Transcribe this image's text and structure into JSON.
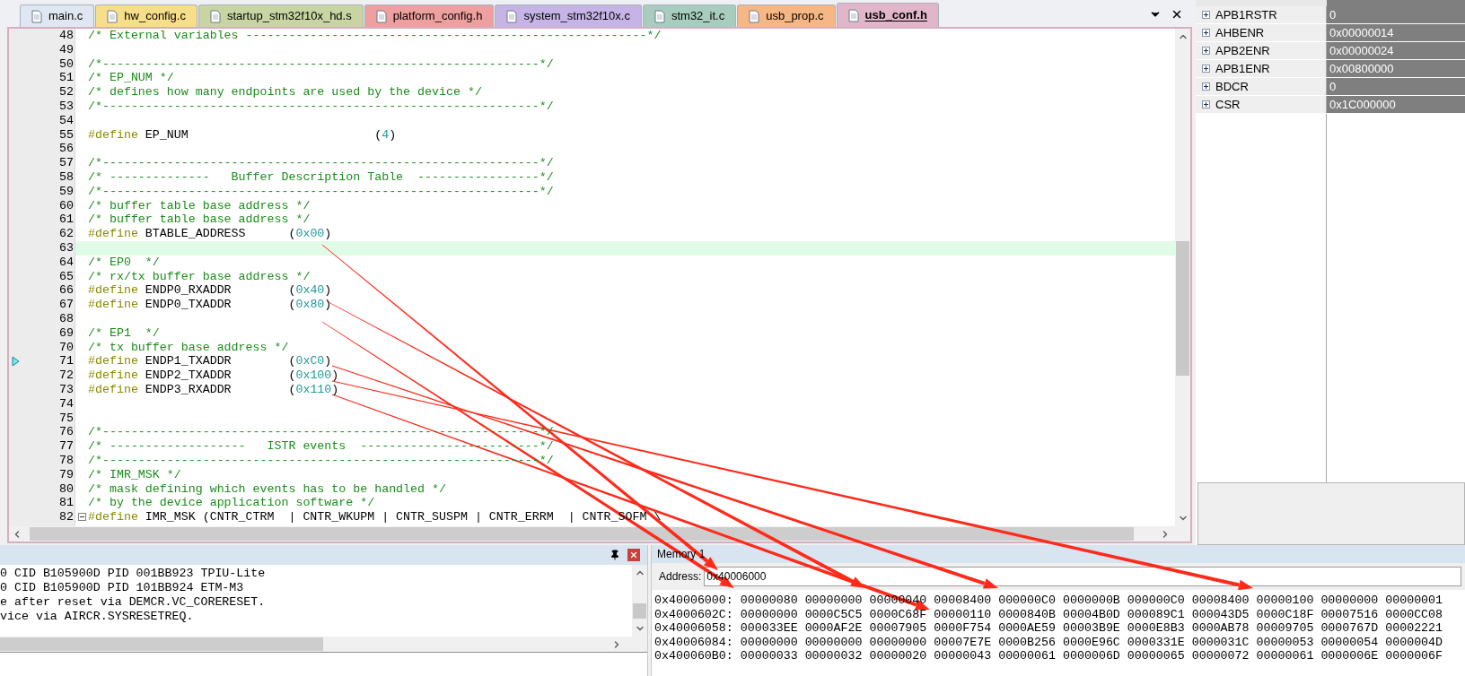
{
  "tabs": [
    {
      "label": "main.c",
      "selected": false,
      "color": "#dfe7f2"
    },
    {
      "label": "hw_config.c",
      "selected": false,
      "color": "#f7de8a"
    },
    {
      "label": "startup_stm32f10x_hd.s",
      "selected": false,
      "color": "#c8d5a2"
    },
    {
      "label": "platform_config.h",
      "selected": false,
      "color": "#ee9f9f"
    },
    {
      "label": "system_stm32f10x.c",
      "selected": false,
      "color": "#c6b4e6"
    },
    {
      "label": "stm32_it.c",
      "selected": false,
      "color": "#a8cdbf"
    },
    {
      "label": "usb_prop.c",
      "selected": false,
      "color": "#f6b784"
    },
    {
      "label": "usb_conf.h",
      "selected": true,
      "color": "#e2b6ca"
    }
  ],
  "editor": {
    "lines": [
      {
        "number": "48",
        "current": false,
        "pc": false,
        "fold": false,
        "tokens": [
          {
            "kind": "comment",
            "text": "/* External variables --------------------------------------------------------*/"
          }
        ]
      },
      {
        "number": "49",
        "current": false,
        "pc": false,
        "fold": false
      },
      {
        "number": "50",
        "current": false,
        "pc": false,
        "fold": false,
        "tokens": [
          {
            "kind": "comment",
            "text": "/*-------------------------------------------------------------*/"
          }
        ]
      },
      {
        "number": "51",
        "current": false,
        "pc": false,
        "fold": false,
        "tokens": [
          {
            "kind": "comment",
            "text": "/* EP_NUM */"
          }
        ]
      },
      {
        "number": "52",
        "current": false,
        "pc": false,
        "fold": false,
        "tokens": [
          {
            "kind": "comment",
            "text": "/* defines how many endpoints are used by the device */"
          }
        ]
      },
      {
        "number": "53",
        "current": false,
        "pc": false,
        "fold": false,
        "tokens": [
          {
            "kind": "comment",
            "text": "/*-------------------------------------------------------------*/"
          }
        ]
      },
      {
        "number": "54",
        "current": false,
        "pc": false,
        "fold": false
      },
      {
        "number": "55",
        "current": false,
        "pc": false,
        "fold": false,
        "tokens": [
          {
            "kind": "directive",
            "text": "#define"
          },
          {
            "kind": "plain",
            "text": " EP_NUM                          ("
          },
          {
            "kind": "number",
            "text": "4"
          },
          {
            "kind": "plain",
            "text": ")"
          }
        ]
      },
      {
        "number": "56",
        "current": false,
        "pc": false,
        "fold": false
      },
      {
        "number": "57",
        "current": false,
        "pc": false,
        "fold": false,
        "tokens": [
          {
            "kind": "comment",
            "text": "/*-------------------------------------------------------------*/"
          }
        ]
      },
      {
        "number": "58",
        "current": false,
        "pc": false,
        "fold": false,
        "tokens": [
          {
            "kind": "comment",
            "text": "/* --------------   Buffer Description Table  -----------------*/"
          }
        ]
      },
      {
        "number": "59",
        "current": false,
        "pc": false,
        "fold": false,
        "tokens": [
          {
            "kind": "comment",
            "text": "/*-------------------------------------------------------------*/"
          }
        ]
      },
      {
        "number": "60",
        "current": false,
        "pc": false,
        "fold": false,
        "tokens": [
          {
            "kind": "comment",
            "text": "/* buffer table base address */"
          }
        ]
      },
      {
        "number": "61",
        "current": false,
        "pc": false,
        "fold": false,
        "tokens": [
          {
            "kind": "comment",
            "text": "/* buffer table base address */"
          }
        ]
      },
      {
        "number": "62",
        "current": false,
        "pc": false,
        "fold": false,
        "tokens": [
          {
            "kind": "directive",
            "text": "#define"
          },
          {
            "kind": "plain",
            "text": " BTABLE_ADDRESS      ("
          },
          {
            "kind": "number",
            "text": "0x00"
          },
          {
            "kind": "plain",
            "text": ")"
          }
        ]
      },
      {
        "number": "63",
        "current": true,
        "pc": false,
        "fold": false
      },
      {
        "number": "64",
        "current": false,
        "pc": false,
        "fold": false,
        "tokens": [
          {
            "kind": "comment",
            "text": "/* EP0  */"
          }
        ]
      },
      {
        "number": "65",
        "current": false,
        "pc": false,
        "fold": false,
        "tokens": [
          {
            "kind": "comment",
            "text": "/* rx/tx buffer base address */"
          }
        ]
      },
      {
        "number": "66",
        "current": false,
        "pc": false,
        "fold": false,
        "tokens": [
          {
            "kind": "directive",
            "text": "#define"
          },
          {
            "kind": "plain",
            "text": " ENDP0_RXADDR        ("
          },
          {
            "kind": "number",
            "text": "0x40"
          },
          {
            "kind": "plain",
            "text": ")"
          }
        ]
      },
      {
        "number": "67",
        "current": false,
        "pc": false,
        "fold": false,
        "tokens": [
          {
            "kind": "directive",
            "text": "#define"
          },
          {
            "kind": "plain",
            "text": " ENDP0_TXADDR        ("
          },
          {
            "kind": "number",
            "text": "0x80"
          },
          {
            "kind": "plain",
            "text": ")"
          }
        ]
      },
      {
        "number": "68",
        "current": false,
        "pc": false,
        "fold": false
      },
      {
        "number": "69",
        "current": false,
        "pc": false,
        "fold": false,
        "tokens": [
          {
            "kind": "comment",
            "text": "/* EP1  */"
          }
        ]
      },
      {
        "number": "70",
        "current": false,
        "pc": false,
        "fold": false,
        "tokens": [
          {
            "kind": "comment",
            "text": "/* tx buffer base address */"
          }
        ]
      },
      {
        "number": "71",
        "current": false,
        "pc": true,
        "fold": false,
        "tokens": [
          {
            "kind": "directive",
            "text": "#define"
          },
          {
            "kind": "plain",
            "text": " ENDP1_TXADDR        ("
          },
          {
            "kind": "number",
            "text": "0xC0"
          },
          {
            "kind": "plain",
            "text": ")"
          }
        ]
      },
      {
        "number": "72",
        "current": false,
        "pc": false,
        "fold": false,
        "tokens": [
          {
            "kind": "directive",
            "text": "#define"
          },
          {
            "kind": "plain",
            "text": " ENDP2_TXADDR        ("
          },
          {
            "kind": "number",
            "text": "0x100"
          },
          {
            "kind": "plain",
            "text": ")"
          }
        ]
      },
      {
        "number": "73",
        "current": false,
        "pc": false,
        "fold": false,
        "tokens": [
          {
            "kind": "directive",
            "text": "#define"
          },
          {
            "kind": "plain",
            "text": " ENDP3_RXADDR        ("
          },
          {
            "kind": "number",
            "text": "0x110"
          },
          {
            "kind": "plain",
            "text": ")"
          }
        ]
      },
      {
        "number": "74",
        "current": false,
        "pc": false,
        "fold": false
      },
      {
        "number": "75",
        "current": false,
        "pc": false,
        "fold": false
      },
      {
        "number": "76",
        "current": false,
        "pc": false,
        "fold": false,
        "tokens": [
          {
            "kind": "comment",
            "text": "/*-------------------------------------------------------------*/"
          }
        ]
      },
      {
        "number": "77",
        "current": false,
        "pc": false,
        "fold": false,
        "tokens": [
          {
            "kind": "comment",
            "text": "/* -------------------   ISTR events  -------------------------*/"
          }
        ]
      },
      {
        "number": "78",
        "current": false,
        "pc": false,
        "fold": false,
        "tokens": [
          {
            "kind": "comment",
            "text": "/*-------------------------------------------------------------*/"
          }
        ]
      },
      {
        "number": "79",
        "current": false,
        "pc": false,
        "fold": false,
        "tokens": [
          {
            "kind": "comment",
            "text": "/* IMR_MSK */"
          }
        ]
      },
      {
        "number": "80",
        "current": false,
        "pc": false,
        "fold": false,
        "tokens": [
          {
            "kind": "comment",
            "text": "/* mask defining which events has to be handled */"
          }
        ]
      },
      {
        "number": "81",
        "current": false,
        "pc": false,
        "fold": false,
        "tokens": [
          {
            "kind": "comment",
            "text": "/* by the device application software */"
          }
        ]
      },
      {
        "number": "82",
        "current": false,
        "pc": false,
        "fold": true,
        "tokens": [
          {
            "kind": "directive",
            "text": "#define"
          },
          {
            "kind": "plain",
            "text": " IMR_MSK (CNTR_CTRM  | CNTR_WKUPM | CNTR_SUSPM | CNTR_ERRM  | CNTR_SOFM \\"
          }
        ]
      }
    ]
  },
  "registers": [
    {
      "name": "APB1RSTR",
      "value": "0",
      "expanded": false
    },
    {
      "name": "AHBENR",
      "value": "0x00000014",
      "expanded": false
    },
    {
      "name": "APB2ENR",
      "value": "0x00000024",
      "expanded": false
    },
    {
      "name": "APB1ENR",
      "value": "0x00800000",
      "expanded": false
    },
    {
      "name": "BDCR",
      "value": "0",
      "expanded": false
    },
    {
      "name": "CSR",
      "value": "0x1C000000",
      "expanded": false
    }
  ],
  "output": {
    "lines": [
      "0 CID B105900D PID 001BB923 TPIU-Lite",
      "0 CID B105900D PID 101BB924 ETM-M3",
      "e after reset via DEMCR.VC_CORERESET.",
      "vice via AIRCR.SYSRESETREQ."
    ]
  },
  "memory": {
    "title": "Memory 1",
    "address_label": "Address:",
    "address": "0x40006000",
    "rows": [
      {
        "address": "0x40006000:",
        "values": [
          "00000080",
          "00000000",
          "00000040",
          "00008400",
          "000000C0",
          "0000000B",
          "000000C0",
          "00008400",
          "00000100",
          "00000000",
          "00000001"
        ]
      },
      {
        "address": "0x4000602C:",
        "values": [
          "00000000",
          "0000C5C5",
          "0000C68F",
          "00000110",
          "0000840B",
          "00004B0D",
          "000089C1",
          "000043D5",
          "0000C18F",
          "00007516",
          "0000CC08"
        ]
      },
      {
        "address": "0x40006058:",
        "values": [
          "000033EE",
          "0000AF2E",
          "00007905",
          "0000F754",
          "0000AE59",
          "00003B9E",
          "0000E8B3",
          "0000AB78",
          "00009705",
          "0000767D",
          "00002221"
        ]
      },
      {
        "address": "0x40006084:",
        "values": [
          "00000000",
          "00000000",
          "00000000",
          "00007E7E",
          "0000B256",
          "0000E96C",
          "0000331E",
          "0000031C",
          "00000053",
          "00000054",
          "0000004D"
        ]
      },
      {
        "address": "0x400060B0:",
        "values": [
          "00000033",
          "00000032",
          "00000020",
          "00000043",
          "00000061",
          "0000006D",
          "00000065",
          "00000072",
          "00000061",
          "0000006E",
          "0000006F"
        ]
      }
    ]
  }
}
